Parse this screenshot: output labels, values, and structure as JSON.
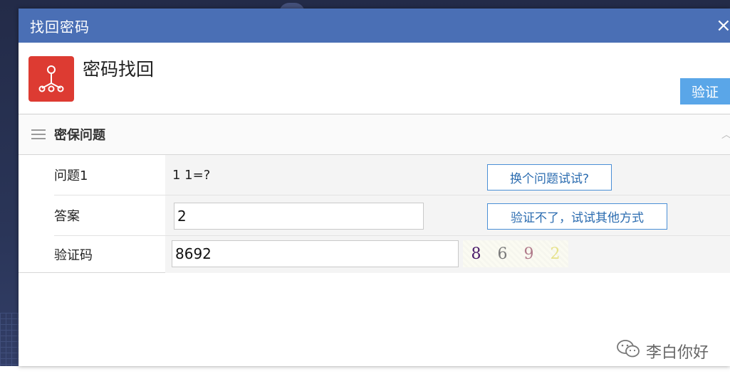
{
  "window": {
    "title": "找回密码",
    "close_glyph": "×"
  },
  "header": {
    "title": "密码找回",
    "icon": "network-tree-icon",
    "verify_label": "验证"
  },
  "section": {
    "title": "密保问题"
  },
  "form": {
    "question": {
      "label": "问题1",
      "text": "1 1=?",
      "change_button": "换个问题试试?"
    },
    "answer": {
      "label": "答案",
      "value": "2",
      "other_button": "验证不了，试试其他方式"
    },
    "captcha": {
      "label": "验证码",
      "value": "8692",
      "image_chars": [
        "8",
        "6",
        "9",
        "2"
      ]
    }
  },
  "watermark": {
    "text": "李白你好",
    "icon": "wechat-icon"
  },
  "colors": {
    "titlebar": "#4a6fb5",
    "app_icon": "#dd3b32",
    "primary_button": "#5aa6e8",
    "link_button_border": "#4a8fd6"
  }
}
